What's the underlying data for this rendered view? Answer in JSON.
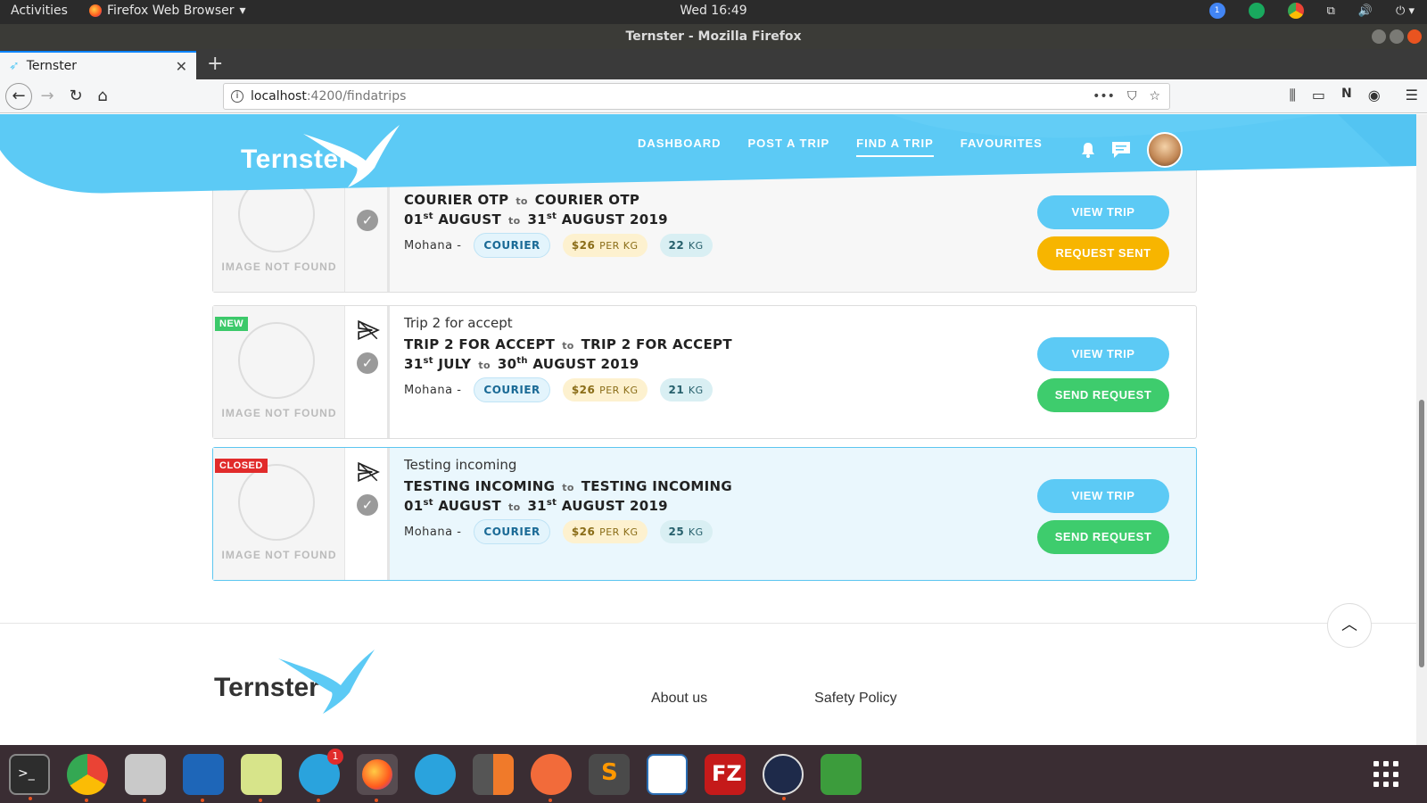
{
  "system": {
    "activities": "Activities",
    "app_menu": "Firefox Web Browser",
    "clock": "Wed 16:49",
    "tray_badge": "1"
  },
  "window": {
    "title": "Ternster - Mozilla Firefox"
  },
  "browser": {
    "tab_title": "Ternster",
    "url_host": "localhost",
    "url_rest": ":4200/findatrips"
  },
  "header": {
    "logo": "Ternster",
    "nav": [
      {
        "label": "DASHBOARD"
      },
      {
        "label": "POST A TRIP"
      },
      {
        "label": "FIND A TRIP"
      },
      {
        "label": "FAVOURITES"
      }
    ]
  },
  "trips": [
    {
      "badge": "",
      "name": "",
      "from": "COURIER OTP",
      "to_word": "to",
      "to": "COURIER OTP",
      "start_day": "01",
      "start_suffix": "st",
      "start_month": "AUGUST",
      "end_day": "31",
      "end_suffix": "st",
      "end_month": "AUGUST 2019",
      "owner": "Mohana -",
      "type": "COURIER",
      "price": "$26",
      "price_unit": "PER KG",
      "weight": "22",
      "weight_unit": "KG",
      "view_label": "VIEW TRIP",
      "action_label": "REQUEST SENT",
      "image_text": "IMAGE NOT FOUND"
    },
    {
      "badge": "NEW",
      "name": "Trip 2 for accept",
      "from": "TRIP 2 FOR ACCEPT",
      "to_word": "to",
      "to": "TRIP 2 FOR ACCEPT",
      "start_day": "31",
      "start_suffix": "st",
      "start_month": "JULY",
      "end_day": "30",
      "end_suffix": "th",
      "end_month": "AUGUST 2019",
      "owner": "Mohana -",
      "type": "COURIER",
      "price": "$26",
      "price_unit": "PER KG",
      "weight": "21",
      "weight_unit": "KG",
      "view_label": "VIEW TRIP",
      "action_label": "SEND REQUEST",
      "image_text": "IMAGE NOT FOUND"
    },
    {
      "badge": "CLOSED",
      "name": "Testing incoming",
      "from": "TESTING INCOMING",
      "to_word": "to",
      "to": "TESTING INCOMING",
      "start_day": "01",
      "start_suffix": "st",
      "start_month": "AUGUST",
      "end_day": "31",
      "end_suffix": "st",
      "end_month": "AUGUST 2019",
      "owner": "Mohana -",
      "type": "COURIER",
      "price": "$26",
      "price_unit": "PER KG",
      "weight": "25",
      "weight_unit": "KG",
      "view_label": "VIEW TRIP",
      "action_label": "SEND REQUEST",
      "image_text": "IMAGE NOT FOUND"
    }
  ],
  "footer": {
    "logo": "Ternster",
    "links": [
      {
        "label": "About us"
      },
      {
        "label": "Safety Policy"
      }
    ]
  },
  "dock": {
    "apps": [
      "terminal",
      "chrome",
      "files",
      "vscode",
      "notes",
      "telegram",
      "firefox",
      "telegram-desktop",
      "calculator",
      "postman",
      "sublime",
      "writer",
      "filezilla",
      "cloud",
      "monkey"
    ],
    "telegram_badge": "1"
  },
  "colors": {
    "brand": "#5ccaf5",
    "send": "#3ecc6d",
    "sent": "#f7b500",
    "badge_new": "#3cc96a",
    "badge_closed": "#e12b2b"
  }
}
